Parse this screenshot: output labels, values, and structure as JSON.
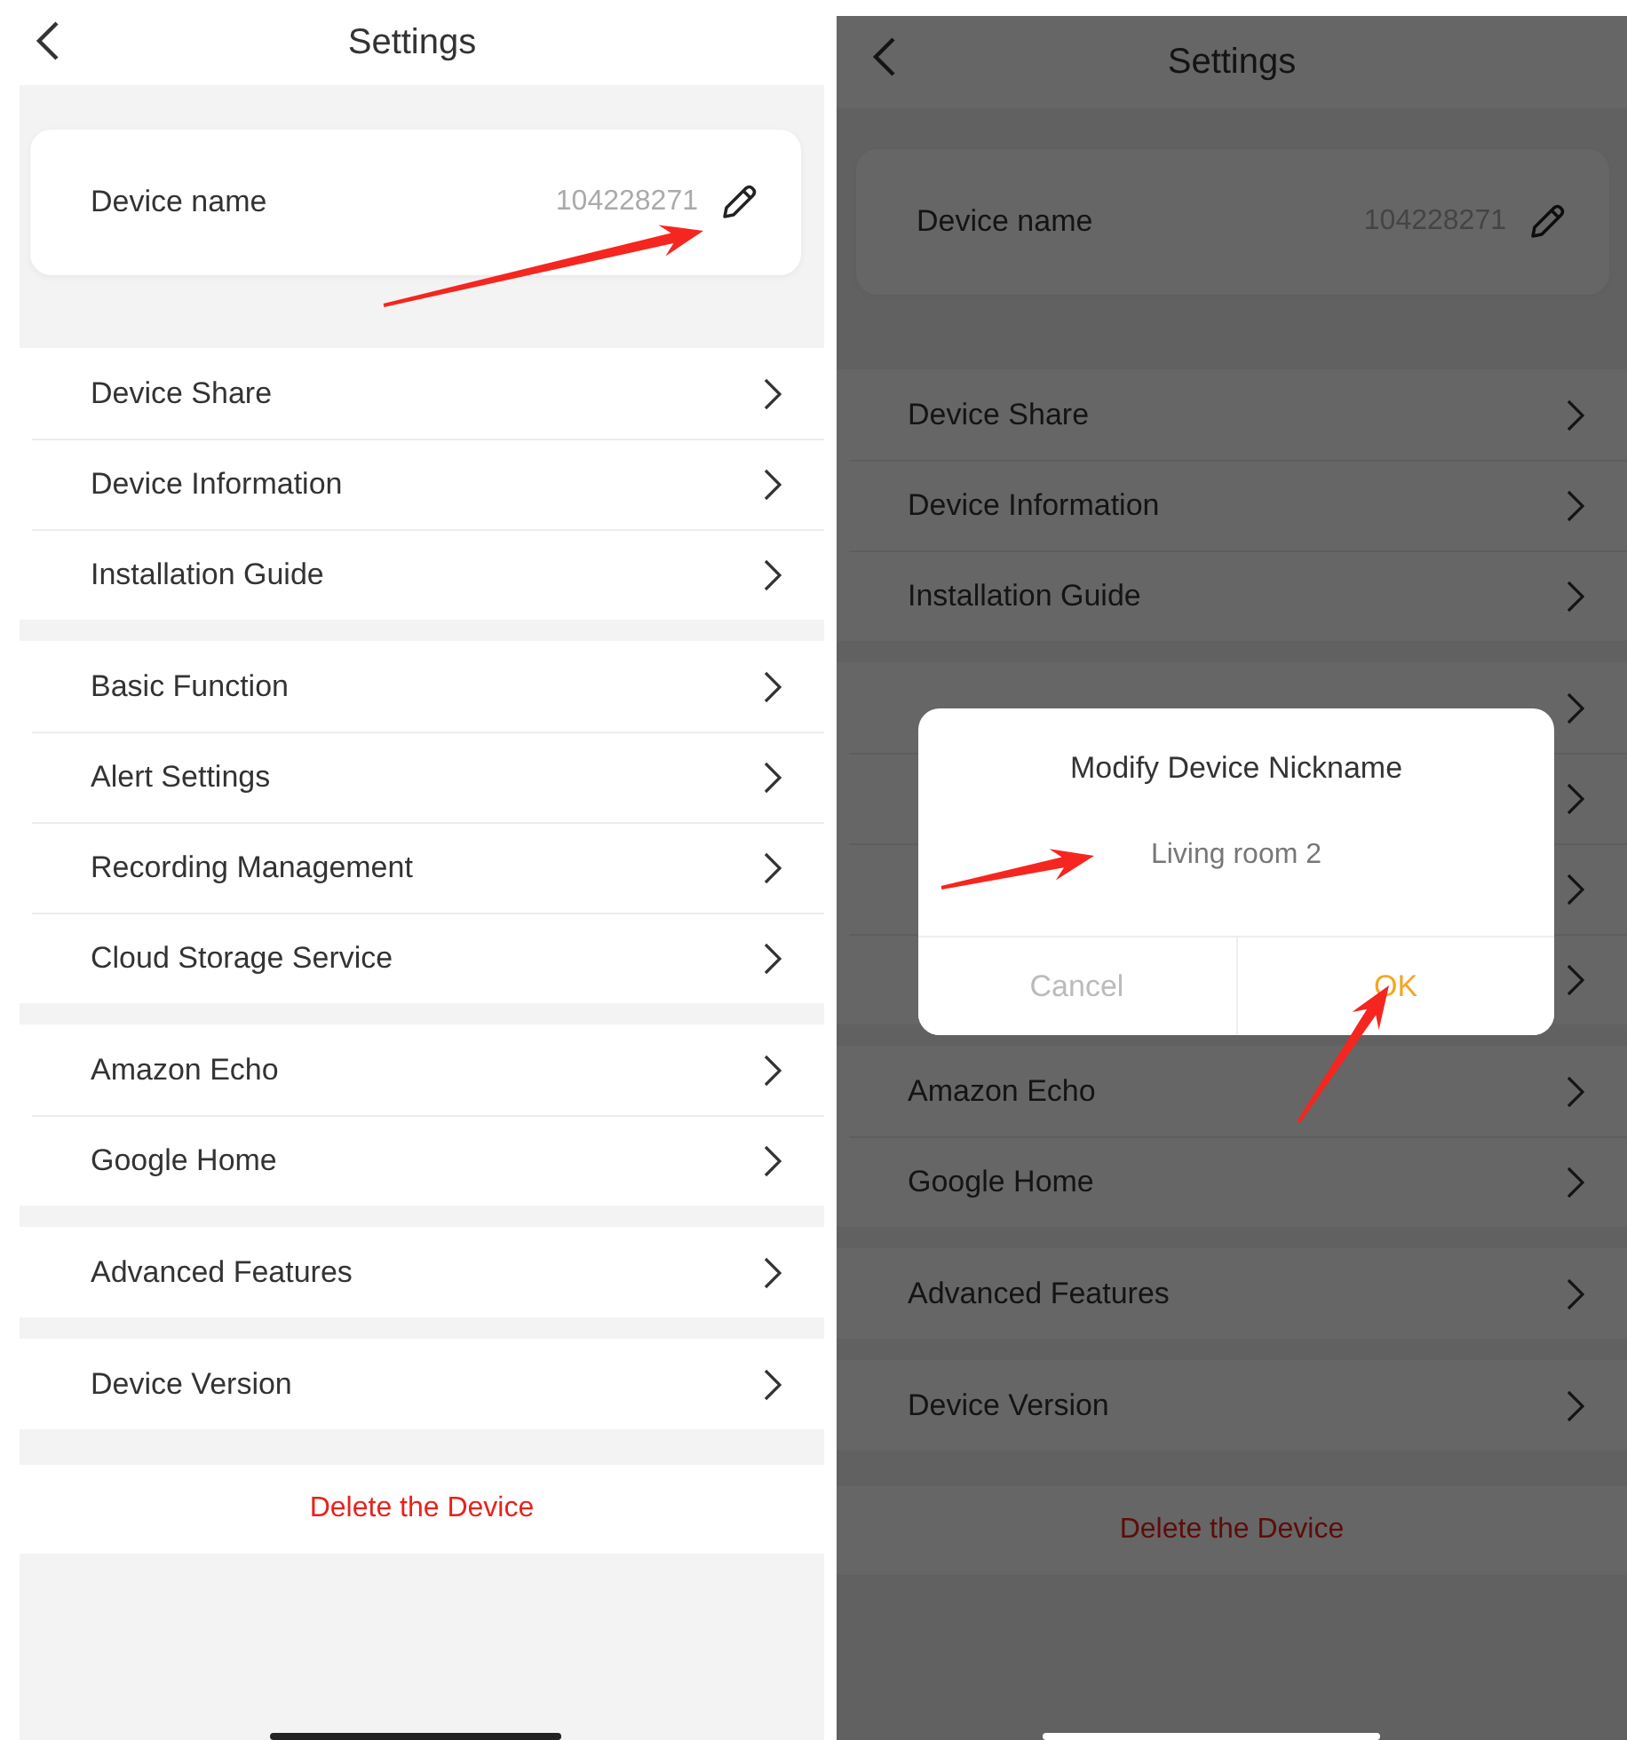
{
  "screens": [
    {
      "dimmed": false,
      "header": {
        "title": "Settings"
      },
      "device_card": {
        "label": "Device name",
        "value": "104228271"
      },
      "groups": [
        [
          {
            "label": "Device Share",
            "chevron": true
          },
          {
            "label": "Device Information",
            "chevron": true
          },
          {
            "label": "Installation Guide",
            "chevron": true
          }
        ],
        [
          {
            "label": "Basic Function",
            "chevron": true
          },
          {
            "label": "Alert Settings",
            "chevron": true
          },
          {
            "label": "Recording Management",
            "chevron": true
          },
          {
            "label": "Cloud Storage Service",
            "chevron": true
          }
        ],
        [
          {
            "label": "Amazon Echo",
            "chevron": true
          },
          {
            "label": "Google Home",
            "chevron": true
          }
        ],
        [
          {
            "label": "Advanced Features",
            "chevron": true
          }
        ],
        [
          {
            "label": "Device Version",
            "chevron": true
          }
        ]
      ],
      "delete_button": "Delete the Device"
    },
    {
      "dimmed": true,
      "header": {
        "title": "Settings"
      },
      "device_card": {
        "label": "Device name",
        "value": "104228271"
      },
      "groups": [
        [
          {
            "label": "Device Share",
            "chevron": true
          },
          {
            "label": "Device Information",
            "chevron": true
          },
          {
            "label": "Installation Guide",
            "chevron": true
          }
        ],
        [
          {
            "chevron": true
          },
          {
            "chevron": true
          },
          {
            "chevron": true
          },
          {
            "chevron": true
          }
        ],
        [
          {
            "label": "Amazon Echo",
            "chevron": true
          },
          {
            "label": "Google Home",
            "chevron": true
          }
        ],
        [
          {
            "label": "Advanced Features",
            "chevron": true
          }
        ],
        [
          {
            "label": "Device Version",
            "chevron": true
          }
        ]
      ],
      "delete_button": "Delete the Device",
      "dialog": {
        "title": "Modify Device Nickname",
        "value": "Living room 2",
        "buttons": [
          {
            "label": "Cancel",
            "kind": "cancel"
          },
          {
            "label": "OK",
            "kind": "confirm"
          }
        ]
      }
    }
  ]
}
